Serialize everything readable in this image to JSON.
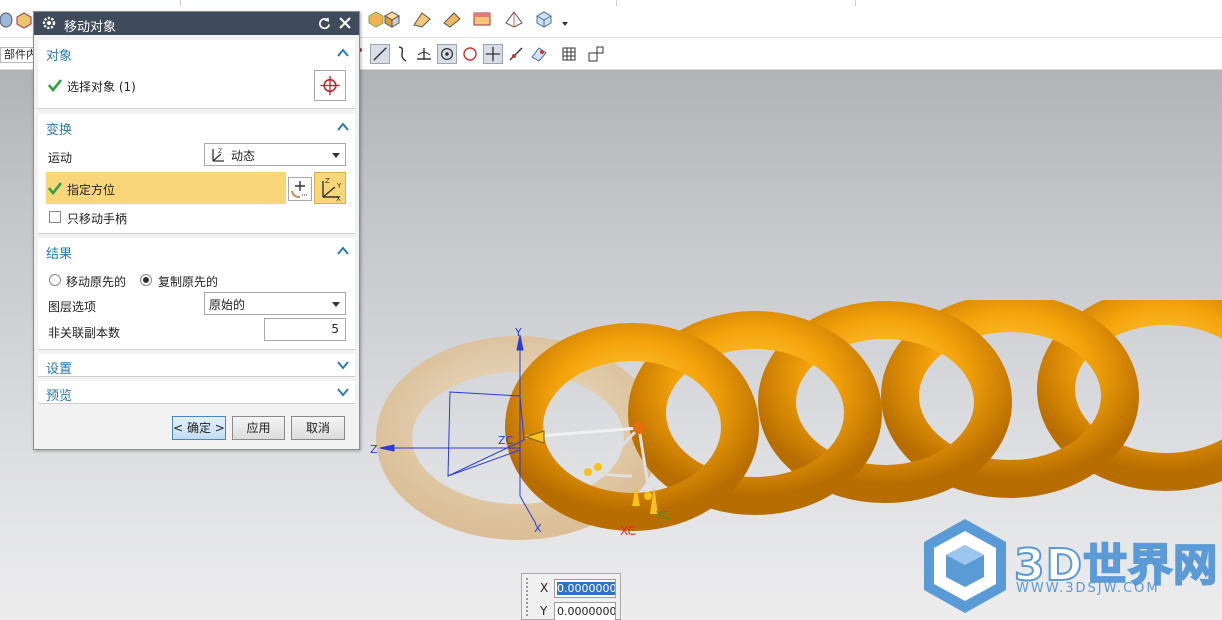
{
  "filter": {
    "label": "部件内"
  },
  "dialog": {
    "title": "移动对象",
    "object_group": {
      "title": "对象",
      "select_label": "选择对象 (1)"
    },
    "transform_group": {
      "title": "变换",
      "motion_label": "运动",
      "motion_value": "动态",
      "specify_label": "指定方位",
      "move_handle_only_label": "只移动手柄",
      "move_handle_only_checked": false
    },
    "result_group": {
      "title": "结果",
      "radio_move": "移动原先的",
      "radio_copy": "复制原先的",
      "selected": "copy",
      "layer_label": "图层选项",
      "layer_value": "原始的",
      "copies_label": "非关联副本数",
      "copies_value": "5"
    },
    "settings_group": {
      "title": "设置"
    },
    "preview_group": {
      "title": "预览"
    },
    "buttons": {
      "ok": "< 确定 >",
      "apply": "应用",
      "cancel": "取消"
    }
  },
  "scene": {
    "axis_labels": {
      "y": "Y",
      "z": "Z",
      "x": "X",
      "zc": "ZC",
      "xc": "XC",
      "yc": "YC"
    }
  },
  "coord_input": {
    "x_label": "X",
    "x_value": "0.0000000",
    "y_label": "Y",
    "y_value": "0.0000000"
  },
  "watermark": {
    "brand": "3D世界网",
    "url": "WWW.3DSJW.COM"
  },
  "colors": {
    "title_bar": "#3f4a5a",
    "highlight_row": "#f9d67a",
    "torus": "#f4a30a",
    "accent_text": "#2a7ab0"
  }
}
